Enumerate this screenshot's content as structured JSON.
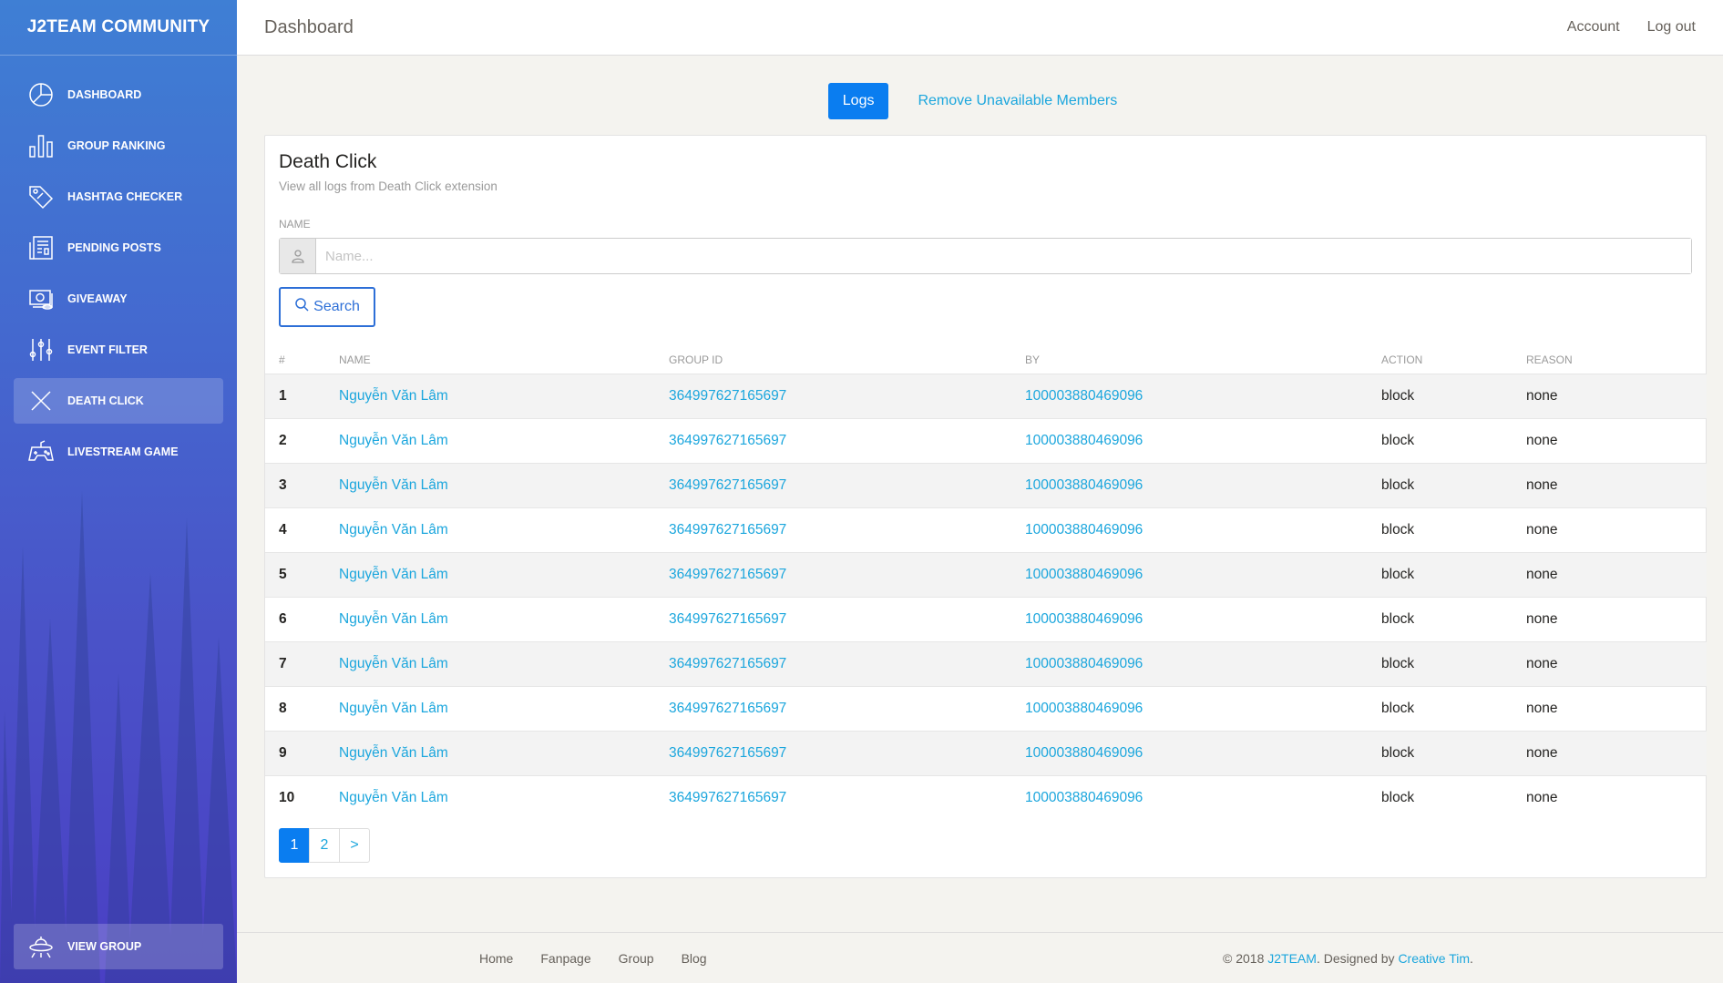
{
  "sidebar": {
    "brand": "J2TEAM COMMUNITY",
    "items": [
      {
        "label": "DASHBOARD",
        "icon": "pie-chart-icon"
      },
      {
        "label": "GROUP RANKING",
        "icon": "bar-chart-icon"
      },
      {
        "label": "HASHTAG CHECKER",
        "icon": "tag-icon"
      },
      {
        "label": "PENDING POSTS",
        "icon": "news-icon"
      },
      {
        "label": "GIVEAWAY",
        "icon": "money-icon"
      },
      {
        "label": "EVENT FILTER",
        "icon": "sliders-icon"
      },
      {
        "label": "DEATH CLICK",
        "icon": "close-icon",
        "active": true
      },
      {
        "label": "LIVESTREAM GAME",
        "icon": "gamepad-icon"
      }
    ],
    "view_group": {
      "label": "VIEW GROUP",
      "icon": "ufo-icon"
    }
  },
  "topbar": {
    "title": "Dashboard",
    "account": "Account",
    "logout": "Log out"
  },
  "tabs": {
    "logs": "Logs",
    "remove": "Remove Unavailable Members"
  },
  "card": {
    "title": "Death Click",
    "subtitle": "View all logs from Death Click extension",
    "name_label": "NAME",
    "name_placeholder": "Name...",
    "search_label": "Search"
  },
  "table": {
    "headers": [
      "#",
      "NAME",
      "GROUP ID",
      "BY",
      "ACTION",
      "REASON"
    ],
    "rows": [
      {
        "n": "1",
        "name": "Nguyễn Văn Lâm",
        "group_id": "364997627165697",
        "by": "100003880469096",
        "action": "block",
        "reason": "none"
      },
      {
        "n": "2",
        "name": "Nguyễn Văn Lâm",
        "group_id": "364997627165697",
        "by": "100003880469096",
        "action": "block",
        "reason": "none"
      },
      {
        "n": "3",
        "name": "Nguyễn Văn Lâm",
        "group_id": "364997627165697",
        "by": "100003880469096",
        "action": "block",
        "reason": "none"
      },
      {
        "n": "4",
        "name": "Nguyễn Văn Lâm",
        "group_id": "364997627165697",
        "by": "100003880469096",
        "action": "block",
        "reason": "none"
      },
      {
        "n": "5",
        "name": "Nguyễn Văn Lâm",
        "group_id": "364997627165697",
        "by": "100003880469096",
        "action": "block",
        "reason": "none"
      },
      {
        "n": "6",
        "name": "Nguyễn Văn Lâm",
        "group_id": "364997627165697",
        "by": "100003880469096",
        "action": "block",
        "reason": "none"
      },
      {
        "n": "7",
        "name": "Nguyễn Văn Lâm",
        "group_id": "364997627165697",
        "by": "100003880469096",
        "action": "block",
        "reason": "none"
      },
      {
        "n": "8",
        "name": "Nguyễn Văn Lâm",
        "group_id": "364997627165697",
        "by": "100003880469096",
        "action": "block",
        "reason": "none"
      },
      {
        "n": "9",
        "name": "Nguyễn Văn Lâm",
        "group_id": "364997627165697",
        "by": "100003880469096",
        "action": "block",
        "reason": "none"
      },
      {
        "n": "10",
        "name": "Nguyễn Văn Lâm",
        "group_id": "364997627165697",
        "by": "100003880469096",
        "action": "block",
        "reason": "none"
      }
    ]
  },
  "pagination": [
    "1",
    "2",
    ">"
  ],
  "footer": {
    "links": [
      "Home",
      "Fanpage",
      "Group",
      "Blog"
    ],
    "copyright_prefix": "© 2018",
    "copyright_brand": "J2TEAM",
    "copyright_mid": ". Designed by",
    "copyright_designer": "Creative Tim",
    "copyright_suffix": "."
  },
  "colors": {
    "primary": "#0a7df0",
    "link": "#1ba6dd",
    "sidebar_top": "#3f7fd4",
    "sidebar_bottom": "#4a3fc4"
  }
}
